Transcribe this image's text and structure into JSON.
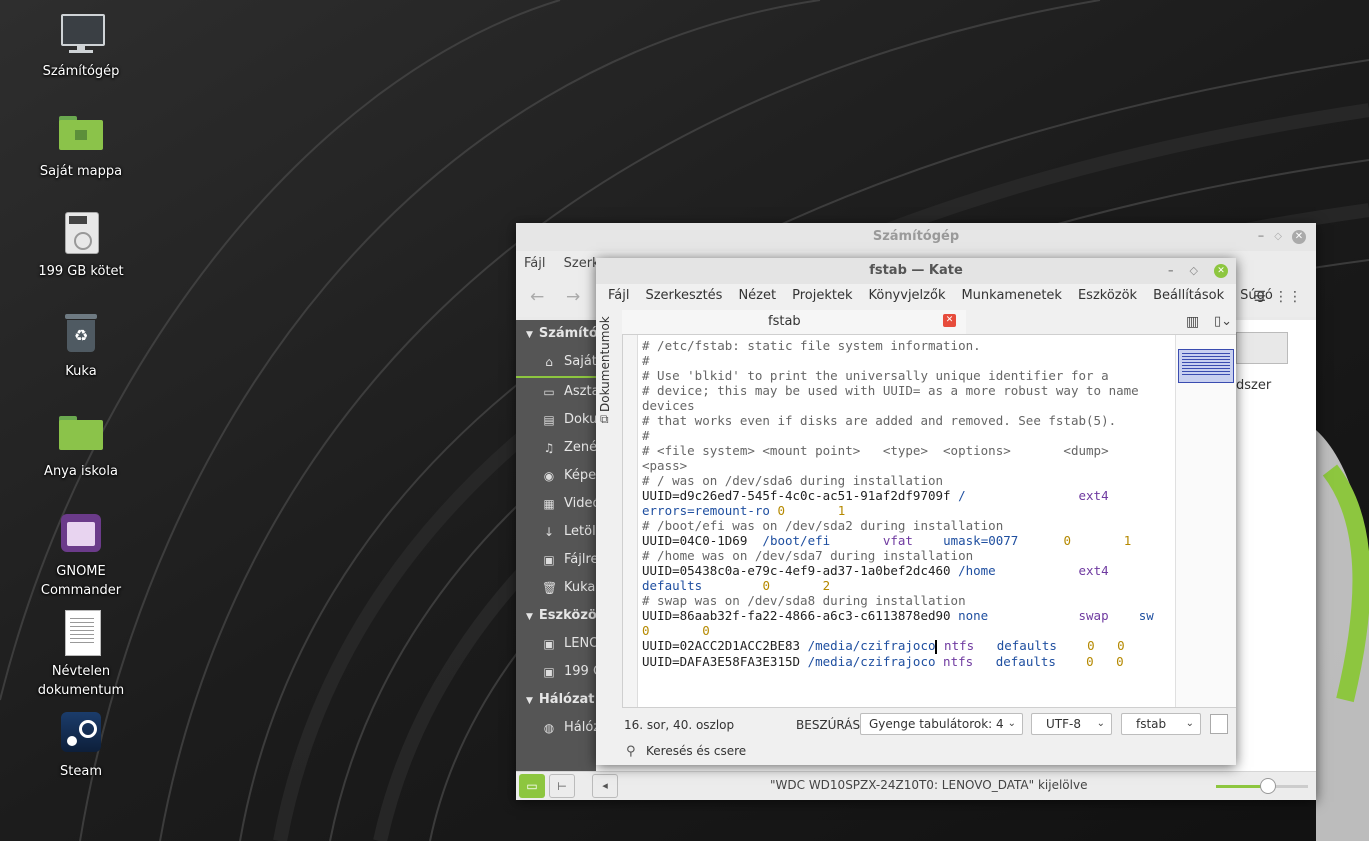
{
  "desktop": {
    "icons": [
      {
        "label": "Számítógép",
        "icon": "computer-icon"
      },
      {
        "label": "Saját mappa",
        "icon": "home-folder-icon"
      },
      {
        "label": "199 GB kötet",
        "icon": "drive-icon"
      },
      {
        "label": "Kuka",
        "icon": "trash-icon"
      },
      {
        "label": "Anya iskola",
        "icon": "folder-icon"
      },
      {
        "label": "GNOME",
        "label2": "Commander",
        "icon": "gnome-commander-icon"
      },
      {
        "label": "Névtelen",
        "label2": "dokumentum",
        "icon": "document-icon"
      },
      {
        "label": "Steam",
        "icon": "steam-icon"
      }
    ]
  },
  "nemo": {
    "title": "Számítógép",
    "menu": [
      "Fájl",
      "Szerke"
    ],
    "sidebar": {
      "sections": [
        {
          "title": "Számítóg",
          "items": [
            "Saját",
            "Aszta",
            "Doku",
            "Zenék",
            "Képek",
            "Videó",
            "Letölt",
            "Fájlre",
            "Kuka"
          ]
        },
        {
          "title": "Eszközök",
          "items": [
            "LENO",
            "199 G"
          ]
        },
        {
          "title": "Hálózat",
          "items": [
            "Hálóz"
          ]
        }
      ]
    },
    "content_partial_label": "dszer",
    "status": "\"WDC WD10SPZX-24Z10T0: LENOVO_DATA\" kijelölve",
    "zoom_level": 0.55
  },
  "kate": {
    "title": "fstab — Kate",
    "menu": [
      "Fájl",
      "Szerkesztés",
      "Nézet",
      "Projektek",
      "Könyvjelzők",
      "Munkamenetek",
      "Eszközök",
      "Beállítások",
      "Súgó"
    ],
    "side_tab": "Dokumentumok",
    "tab": "fstab",
    "lines": [
      [
        {
          "t": "# /etc/fstab: static file system information.",
          "c": "cm"
        }
      ],
      [
        {
          "t": "#",
          "c": "cm"
        }
      ],
      [
        {
          "t": "# Use 'blkid' to print the universally unique identifier for a",
          "c": "cm"
        }
      ],
      [
        {
          "t": "# device; this may be used with UUID= as a more robust way to name",
          "c": "cm"
        }
      ],
      [
        {
          "t": "devices",
          "c": "cm"
        }
      ],
      [
        {
          "t": "# that works even if disks are added and removed. See fstab(5).",
          "c": "cm"
        }
      ],
      [
        {
          "t": "#",
          "c": "cm"
        }
      ],
      [
        {
          "t": "# <file system> <mount point>   <type>  <options>       <dump>",
          "c": "cm"
        }
      ],
      [
        {
          "t": "<pass>",
          "c": "cm"
        }
      ],
      [
        {
          "t": "# / was on /dev/sda6 during installation",
          "c": "cm"
        }
      ],
      [
        {
          "t": "UUID=d9c26ed7-545f-4c0c-ac51-91af2df9709f ",
          "c": "cu"
        },
        {
          "t": "/",
          "c": "cp"
        },
        {
          "t": "               ",
          "c": "cu"
        },
        {
          "t": "ext4",
          "c": "ct"
        }
      ],
      [
        {
          "t": "errors=remount-ro",
          "c": "cp"
        },
        {
          "t": " ",
          "c": "cu"
        },
        {
          "t": "0",
          "c": "cn"
        },
        {
          "t": "       ",
          "c": "cu"
        },
        {
          "t": "1",
          "c": "cn"
        }
      ],
      [
        {
          "t": "# /boot/efi was on /dev/sda2 during installation",
          "c": "cm"
        }
      ],
      [
        {
          "t": "UUID=04C0-1D69  ",
          "c": "cu"
        },
        {
          "t": "/boot/efi",
          "c": "cp"
        },
        {
          "t": "       ",
          "c": "cu"
        },
        {
          "t": "vfat",
          "c": "ct"
        },
        {
          "t": "    ",
          "c": "cu"
        },
        {
          "t": "umask=0077",
          "c": "cp"
        },
        {
          "t": "      ",
          "c": "cu"
        },
        {
          "t": "0",
          "c": "cn"
        },
        {
          "t": "       ",
          "c": "cu"
        },
        {
          "t": "1",
          "c": "cn"
        }
      ],
      [
        {
          "t": "# /home was on /dev/sda7 during installation",
          "c": "cm"
        }
      ],
      [
        {
          "t": "UUID=05438c0a-e79c-4ef9-ad37-1a0bef2dc460 ",
          "c": "cu"
        },
        {
          "t": "/home",
          "c": "cp"
        },
        {
          "t": "           ",
          "c": "cu"
        },
        {
          "t": "ext4",
          "c": "ct"
        }
      ],
      [
        {
          "t": "defaults",
          "c": "cp"
        },
        {
          "t": "        ",
          "c": "cu"
        },
        {
          "t": "0",
          "c": "cn"
        },
        {
          "t": "       ",
          "c": "cu"
        },
        {
          "t": "2",
          "c": "cn"
        }
      ],
      [
        {
          "t": "# swap was on /dev/sda8 during installation",
          "c": "cm"
        }
      ],
      [
        {
          "t": "UUID=86aab32f-fa22-4866-a6c3-c6113878ed90 ",
          "c": "cu"
        },
        {
          "t": "none",
          "c": "cp"
        },
        {
          "t": "            ",
          "c": "cu"
        },
        {
          "t": "swap",
          "c": "ct"
        },
        {
          "t": "    ",
          "c": "cu"
        },
        {
          "t": "sw",
          "c": "cp"
        }
      ],
      [
        {
          "t": "0",
          "c": "cn"
        },
        {
          "t": "       ",
          "c": "cu"
        },
        {
          "t": "0",
          "c": "cn"
        }
      ],
      [
        {
          "t": "UUID=02ACC2D1ACC2BE83 ",
          "c": "cu"
        },
        {
          "t": "/media/czifrajoco",
          "c": "cp"
        },
        {
          "t": " ",
          "c": "cu"
        },
        {
          "t": "ntfs",
          "c": "ct"
        },
        {
          "t": "   ",
          "c": "cu"
        },
        {
          "t": "defaults",
          "c": "cp"
        },
        {
          "t": "    ",
          "c": "cu"
        },
        {
          "t": "0",
          "c": "cn"
        },
        {
          "t": "   ",
          "c": "cu"
        },
        {
          "t": "0",
          "c": "cn"
        }
      ],
      [
        {
          "t": "UUID=DAFA3E58FA3E315D ",
          "c": "cu"
        },
        {
          "t": "/media/czifrajoco",
          "c": "cp"
        },
        {
          "t": " ",
          "c": "cu"
        },
        {
          "t": "ntfs",
          "c": "ct"
        },
        {
          "t": "   ",
          "c": "cu"
        },
        {
          "t": "defaults",
          "c": "cp"
        },
        {
          "t": "    ",
          "c": "cu"
        },
        {
          "t": "0",
          "c": "cn"
        },
        {
          "t": "   ",
          "c": "cu"
        },
        {
          "t": "0",
          "c": "cn"
        }
      ]
    ],
    "status": {
      "position": "16. sor, 40. oszlop",
      "mode": "BESZÚRÁS",
      "indent": "Gyenge tabulátorok: 4",
      "encoding": "UTF-8",
      "filetype": "fstab"
    },
    "search_label": "Keresés és csere"
  }
}
